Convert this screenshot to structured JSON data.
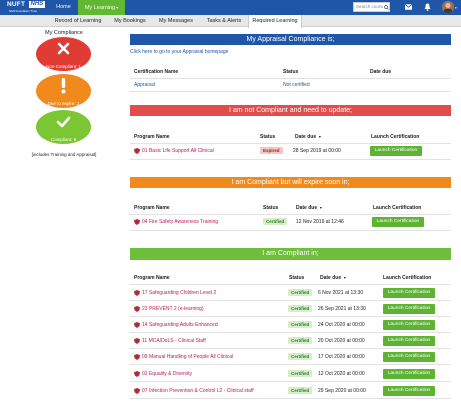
{
  "header": {
    "logo_main": "NUFT",
    "logo_nhs": "NHS",
    "logo_sub": "NHS Foundation Trust",
    "nav_home": "Home",
    "nav_learning": "My Learning",
    "search_placeholder": "Search course",
    "icons": [
      "search-icon",
      "mail-icon",
      "bell-icon",
      "avatar"
    ]
  },
  "subnav": {
    "tabs": [
      {
        "label": "Record of Learning"
      },
      {
        "label": "My Bookings"
      },
      {
        "label": "My Messages"
      },
      {
        "label": "Tasks & Alerts"
      },
      {
        "label": "Required Learning"
      }
    ],
    "active": "Required Learning"
  },
  "compliance": {
    "title": "My Compliance",
    "statuses": [
      {
        "label": "Non-Compliant: 1",
        "color": "#e03c35",
        "icon": "close-icon"
      },
      {
        "label": "Due to expire: 1",
        "color": "#f18a1c",
        "icon": "exclamation-icon"
      },
      {
        "label": "Compliant: 8",
        "color": "#7cc633",
        "icon": "check-icon"
      }
    ],
    "note": "[includes Training and Appraisal]"
  },
  "appraisal": {
    "banner": "My Appraisal Compliance is;",
    "link": "Click here to go to your Appraisal homepage",
    "headers": [
      "Certification Name",
      "Status",
      "Date due"
    ],
    "row": {
      "name": "Appraisal",
      "status": "Not certified",
      "date": ""
    }
  },
  "not_compliant": {
    "banner": "I am not Compliant and need to update;",
    "headers": [
      "Program Name",
      "Status",
      "Date due",
      "Launch Certification"
    ],
    "rows": [
      {
        "name": "01 Basic Life Support All Clinical",
        "status": "Expired",
        "date": "28 Sep 2019 at 00:00",
        "action": "Launch Certification"
      }
    ]
  },
  "expiring": {
    "banner": "I am Compliant but will expire soon in;",
    "headers": [
      "Program Name",
      "Status",
      "Date due",
      "Launch Certification"
    ],
    "rows": [
      {
        "name": "04 Fire Safety Awareness Training",
        "status": "Certified",
        "date": "12 Nov 2019 at 12:46",
        "action": "Launch Certification"
      }
    ]
  },
  "compliant": {
    "banner": "I am Compliant in;",
    "headers": [
      "Program Name",
      "Status",
      "Date due",
      "Launch Certification"
    ],
    "rows": [
      {
        "name": "17 Safeguarding Children Level 2",
        "status": "Certified",
        "date": "6 Nov 2021 at 13:30",
        "action": "Launch Certification"
      },
      {
        "name": "23 PREVENT 2 (e-learning)",
        "status": "Certified",
        "date": "26 Sep 2021 at 13:30",
        "action": "Launch Certification"
      },
      {
        "name": "14 Safeguarding Adults Enhanced",
        "status": "Certified",
        "date": "24 Oct 2020 at 00:00",
        "action": "Launch Certification"
      },
      {
        "name": "11 MCA/DoLS - Clinical Staff",
        "status": "Certified",
        "date": "20 Oct 2020 at 00:00",
        "action": "Launch Certification"
      },
      {
        "name": "09 Manual Handling of People All Clinical",
        "status": "Certified",
        "date": "17 Oct 2020 at 00:00",
        "action": "Launch Certification"
      },
      {
        "name": "02 Equality & Diversity",
        "status": "Certified",
        "date": "12 Oct 2020 at 00:00",
        "action": "Launch Certification"
      },
      {
        "name": "07 Infection Prevention & Control L2 - Clinical staff",
        "status": "Certified",
        "date": "29 Sep 2020 at 00:00",
        "action": "Launch Certification"
      }
    ]
  }
}
